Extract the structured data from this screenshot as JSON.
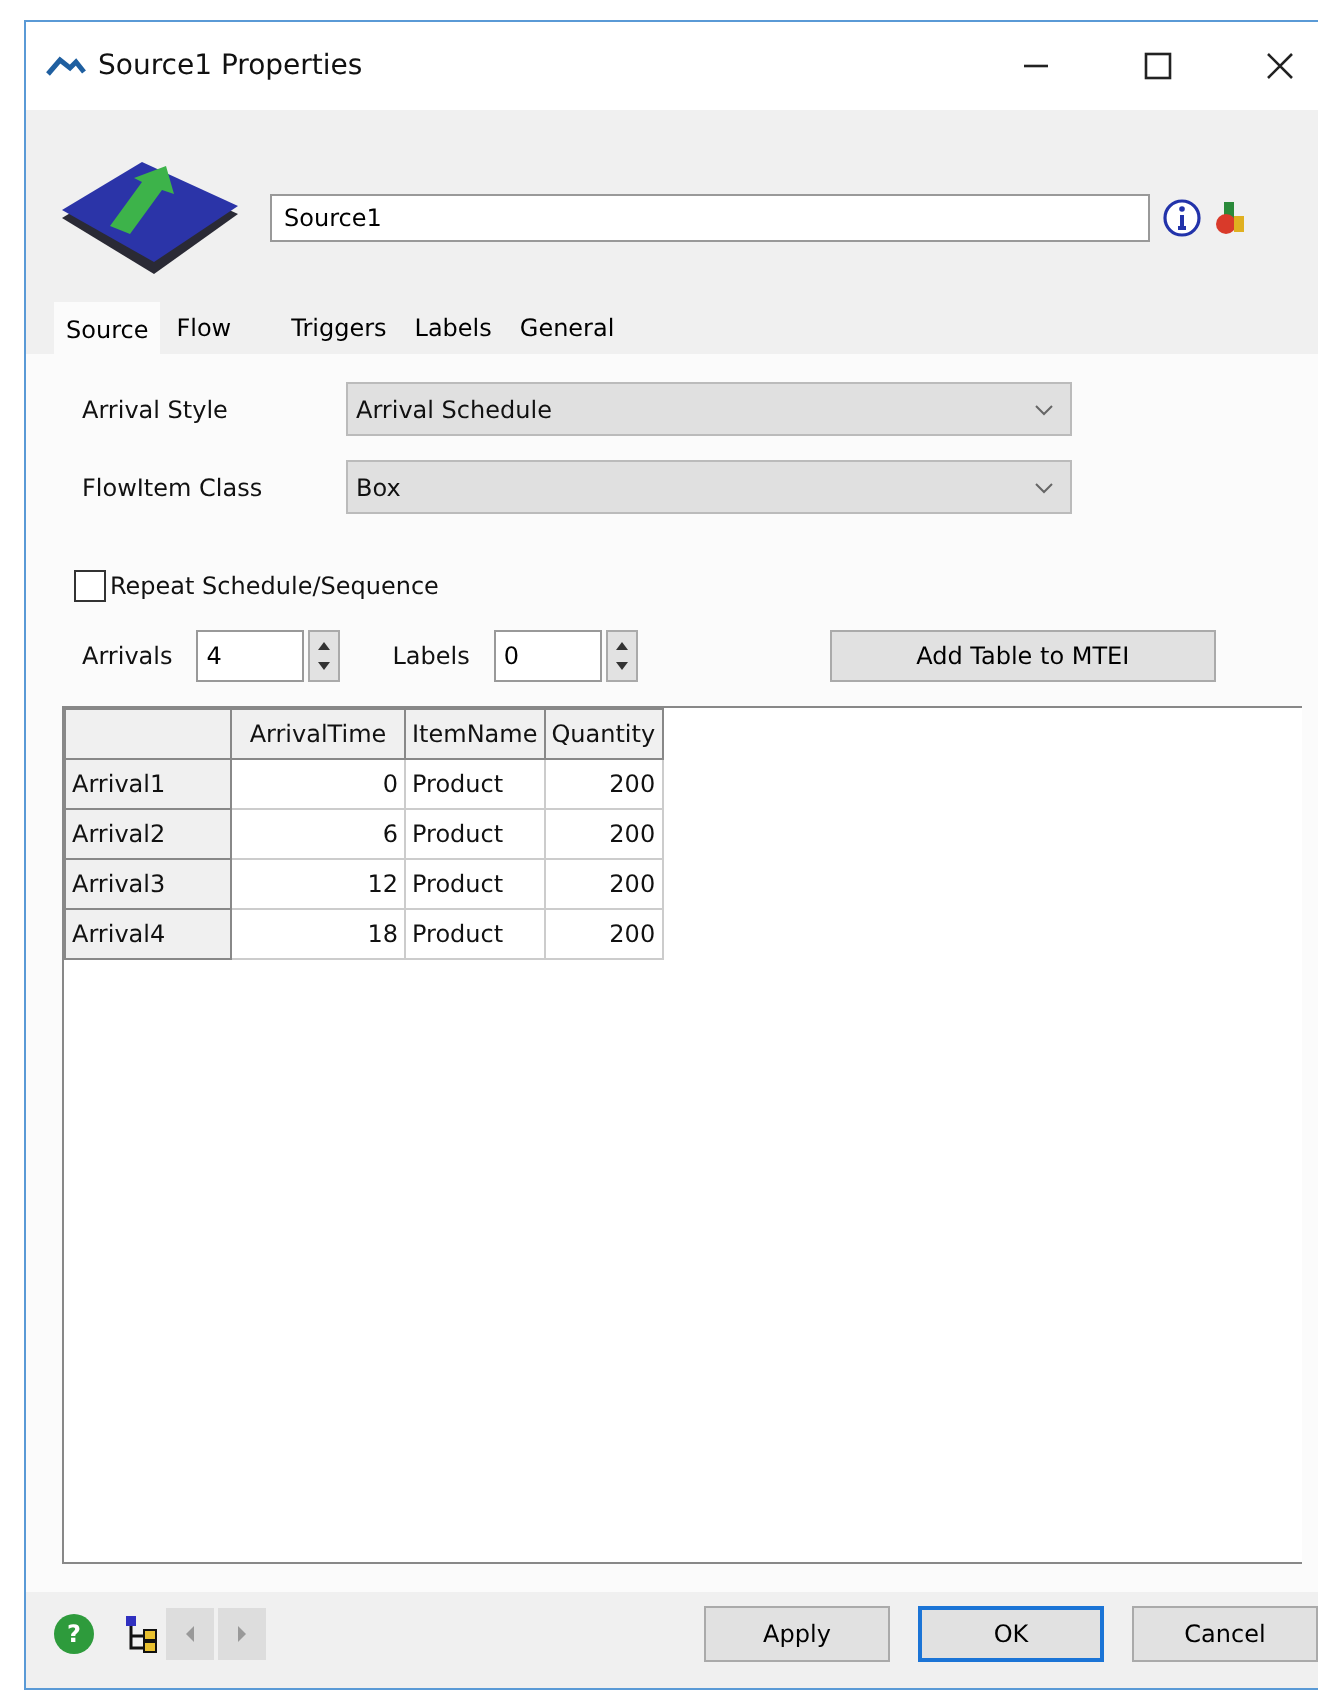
{
  "window": {
    "title": "Source1  Properties"
  },
  "name_field": {
    "value": "Source1"
  },
  "tabs": [
    {
      "label": "Source",
      "selected": true
    },
    {
      "label": "Flow",
      "selected": false
    },
    {
      "label": "Triggers",
      "selected": false
    },
    {
      "label": "Labels",
      "selected": false
    },
    {
      "label": "General",
      "selected": false
    }
  ],
  "fields": [
    {
      "label": "Arrival Style",
      "value": "Arrival Schedule"
    },
    {
      "label": "FlowItem Class",
      "value": "Box"
    }
  ],
  "repeat": {
    "label": "Repeat Schedule/Sequence",
    "checked": false
  },
  "spinners": [
    {
      "label": "Arrivals",
      "value": "4"
    },
    {
      "label": "Labels",
      "value": "0"
    }
  ],
  "add_table_button": "Add Table to MTEI",
  "table": {
    "columns": [
      "ArrivalTime",
      "ItemName",
      "Quantity"
    ],
    "rows": [
      {
        "header": "Arrival1",
        "cells": [
          "0",
          "Product",
          "200"
        ]
      },
      {
        "header": "Arrival2",
        "cells": [
          "6",
          "Product",
          "200"
        ]
      },
      {
        "header": "Arrival3",
        "cells": [
          "12",
          "Product",
          "200"
        ]
      },
      {
        "header": "Arrival4",
        "cells": [
          "18",
          "Product",
          "200"
        ]
      }
    ]
  },
  "help": "?",
  "buttons": [
    {
      "label": "Apply",
      "default": false
    },
    {
      "label": "OK",
      "default": true
    },
    {
      "label": "Cancel",
      "default": false
    }
  ]
}
